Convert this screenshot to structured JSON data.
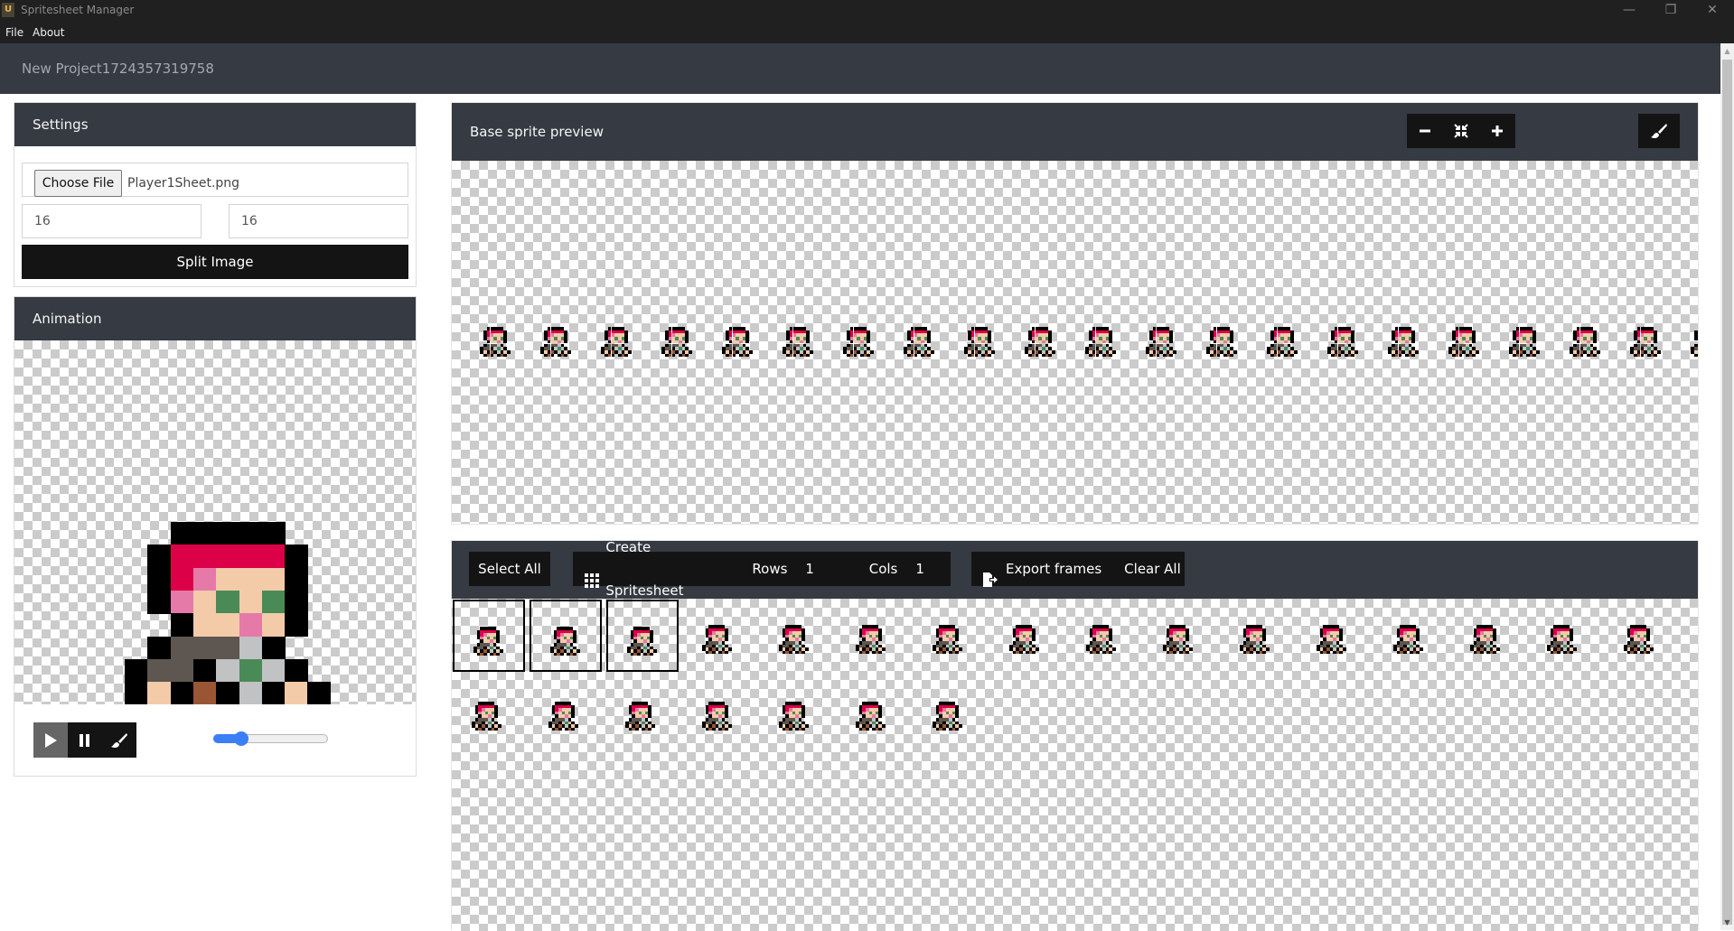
{
  "window": {
    "title": "Spritesheet Manager",
    "app_icon_letter": "U",
    "controls": {
      "minimize": "—",
      "maximize": "❐",
      "close": "✕"
    }
  },
  "menu": {
    "items": [
      "File",
      "About"
    ]
  },
  "project": {
    "name": "New Project1724357319758"
  },
  "settings": {
    "title": "Settings",
    "choose_file_label": "Choose File",
    "file_name": "Player1Sheet.png",
    "frame_width": "16",
    "frame_height": "16",
    "split_label": "Split Image"
  },
  "animation": {
    "title": "Animation",
    "controls": [
      {
        "name": "play-button",
        "icon": "play-icon",
        "active": true
      },
      {
        "name": "pause-button",
        "icon": "pause-icon",
        "active": false
      },
      {
        "name": "brush-button",
        "icon": "brush-icon",
        "active": false
      }
    ],
    "speed_fraction": 0.24
  },
  "preview": {
    "title": "Base sprite preview",
    "tools": [
      "zoom-out-icon",
      "fit-icon",
      "zoom-in-icon"
    ],
    "brush_tool": "brush-icon",
    "sprite_count": 21
  },
  "frames": {
    "select_all_label": "Select All",
    "create_label": "Create Spritesheet",
    "rows_label": "Rows",
    "rows_value": "1",
    "cols_label": "Cols",
    "cols_value": "1",
    "export_label": "Export frames",
    "clear_label": "Clear All",
    "count": 23,
    "selected": [
      0,
      1,
      2
    ]
  },
  "colors": {
    "hair": "#dc0048",
    "hair_light": "#e57aa8",
    "skin": "#f3cba8",
    "eye": "#4a8a56",
    "coat": "#5e5650",
    "shirt": "#c0c2c4",
    "boot": "#9a5634",
    "outline": "#000000",
    "header": "#363a42",
    "accent": "#3b7ff5"
  }
}
